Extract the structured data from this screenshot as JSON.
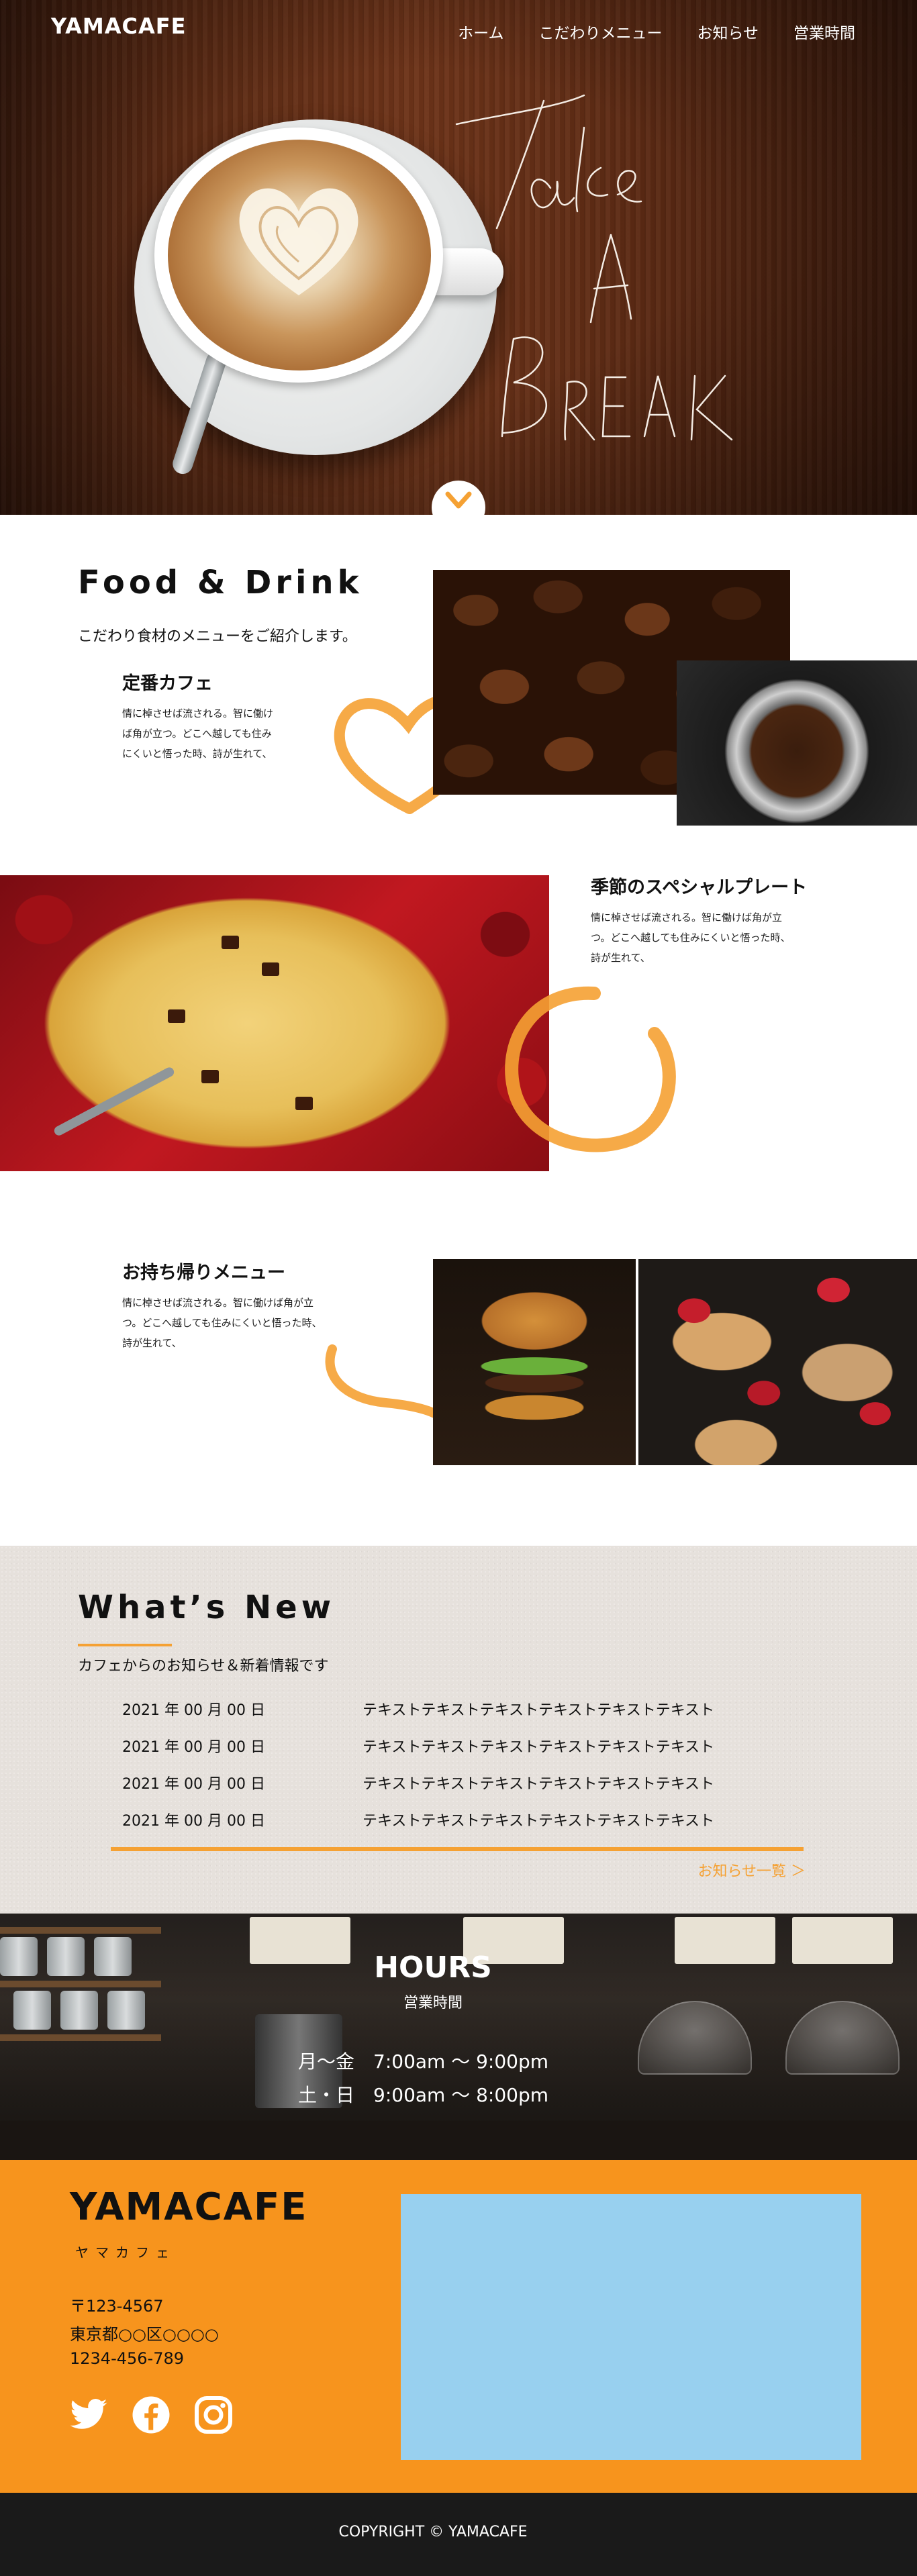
{
  "header": {
    "logo": "YAMACAFE",
    "nav": [
      "ホーム",
      "こだわりメニュー",
      "お知らせ",
      "営業時間"
    ]
  },
  "hero": {
    "script_lines": [
      "Take",
      "A",
      "BREAK"
    ],
    "scroll_icon": "chevron-down-icon"
  },
  "food": {
    "title": "Food & Drink",
    "lead": "こだわり食材のメニューをご紹介します。",
    "items": [
      {
        "title": "定番カフェ",
        "text": [
          "情に棹させば流される。智に働け",
          "ば角が立つ。どこへ越しても住み",
          "にくいと悟った時、詩が生れて、"
        ]
      },
      {
        "title": "季節のスペシャルプレート",
        "text": [
          "情に棹させば流される。智に働けば角が立",
          "つ。どこへ越しても住みにくいと悟った時、",
          "詩が生れて、"
        ]
      },
      {
        "title": "お持ち帰りメニュー",
        "text": [
          "情に棹させば流される。智に働けば角が立",
          "つ。どこへ越しても住みにくいと悟った時、",
          "詩が生れて、"
        ]
      }
    ]
  },
  "news": {
    "title": "What’s New",
    "lead": "カフェからのお知らせ＆新着情報です",
    "rows": [
      {
        "date": "2021 年 00 月 00 日",
        "text": "テキストテキストテキストテキストテキストテキスト"
      },
      {
        "date": "2021 年 00 月 00 日",
        "text": "テキストテキストテキストテキストテキストテキスト"
      },
      {
        "date": "2021 年 00 月 00 日",
        "text": "テキストテキストテキストテキストテキストテキスト"
      },
      {
        "date": "2021 年 00 月 00 日",
        "text": "テキストテキストテキストテキストテキストテキスト"
      }
    ],
    "more_link": "お知らせ一覧 ＞"
  },
  "hours": {
    "title": "HOURS",
    "subtitle": "営業時間",
    "lines": [
      "月〜金　7:00am 〜 9:00pm",
      "土・日　9:00am 〜 8:00pm"
    ]
  },
  "footer": {
    "logo": "YAMACAFE",
    "kana": "ヤマカフェ",
    "postal": "〒123-4567",
    "address": "東京都○○区○○○○",
    "phone": "1234-456-789",
    "social_icons": [
      "twitter-icon",
      "facebook-icon",
      "instagram-icon"
    ],
    "copyright": "COPYRIGHT © YAMACAFE"
  },
  "colors": {
    "accent": "#f7941d",
    "accent_light": "#f5a133",
    "map_placeholder": "#98d0ef",
    "news_bg": "#e6e1dc",
    "footer_bar": "#1a1a1a"
  }
}
